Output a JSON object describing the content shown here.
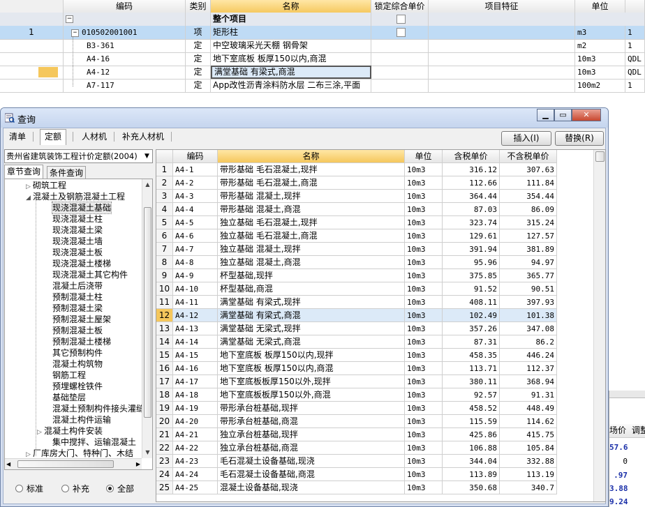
{
  "background_table": {
    "headers": [
      "编码",
      "类别",
      "名称",
      "锁定综合单价",
      "项目特征",
      "单位",
      ""
    ],
    "group_row": {
      "label": "整个项目"
    },
    "rows": [
      {
        "num": "1",
        "code": "010502001001",
        "type": "项",
        "name": "矩形柱",
        "unit": "m3",
        "qty": "1"
      },
      {
        "num": "",
        "code": "B3-361",
        "type": "定",
        "name": "中空玻璃采光天棚 钢骨架",
        "unit": "m2",
        "qty": "1"
      },
      {
        "num": "",
        "code": "A4-16",
        "type": "定",
        "name": "地下室底板 板厚150以内,商混",
        "unit": "10m3",
        "qty": "QDL"
      },
      {
        "num": "",
        "code": "A4-12",
        "type": "定",
        "name": "满堂基础 有梁式,商混",
        "unit": "10m3",
        "qty": "QDL"
      },
      {
        "num": "",
        "code": "A7-117",
        "type": "定",
        "name": "App改性沥青涂料防水层 二布三涂,平面",
        "unit": "100m2",
        "qty": "1"
      }
    ]
  },
  "dialog": {
    "title": "查询",
    "tabs": [
      "清单",
      "定额",
      "人材机",
      "补充人材机"
    ],
    "active_tab": "定额",
    "insert_button": "插入(I)",
    "replace_button": "替换(R)",
    "quota_library": "贵州省建筑装饰工程计价定额(2004)",
    "left_tabs": [
      "章节查询",
      "条件查询"
    ],
    "tree": [
      {
        "label": "砌筑工程",
        "level": 1,
        "toggle": "▷"
      },
      {
        "label": "混凝土及钢筋混凝土工程",
        "level": 1,
        "toggle": "◢"
      },
      {
        "label": "现浇混凝土基础",
        "level": 2,
        "toggle": "",
        "selected": true
      },
      {
        "label": "现浇混凝土柱",
        "level": 2,
        "toggle": ""
      },
      {
        "label": "现浇混凝土梁",
        "level": 2,
        "toggle": ""
      },
      {
        "label": "现浇混凝土墙",
        "level": 2,
        "toggle": ""
      },
      {
        "label": "现浇混凝土板",
        "level": 2,
        "toggle": ""
      },
      {
        "label": "现浇混凝土楼梯",
        "level": 2,
        "toggle": ""
      },
      {
        "label": "现浇混凝土其它构件",
        "level": 2,
        "toggle": ""
      },
      {
        "label": "混凝土后浇带",
        "level": 2,
        "toggle": ""
      },
      {
        "label": "预制混凝土柱",
        "level": 2,
        "toggle": ""
      },
      {
        "label": "预制混凝土梁",
        "level": 2,
        "toggle": ""
      },
      {
        "label": "预制混凝土屋架",
        "level": 2,
        "toggle": ""
      },
      {
        "label": "预制混凝土板",
        "level": 2,
        "toggle": ""
      },
      {
        "label": "预制混凝土楼梯",
        "level": 2,
        "toggle": ""
      },
      {
        "label": "其它预制构件",
        "level": 2,
        "toggle": ""
      },
      {
        "label": "混凝土构筑物",
        "level": 2,
        "toggle": ""
      },
      {
        "label": "钢筋工程",
        "level": 2,
        "toggle": ""
      },
      {
        "label": "预埋螺栓铁件",
        "level": 2,
        "toggle": ""
      },
      {
        "label": "基础垫层",
        "level": 2,
        "toggle": ""
      },
      {
        "label": "混凝土预制构件接头灌缝",
        "level": 2,
        "toggle": ""
      },
      {
        "label": "混凝土构件运输",
        "level": 2,
        "toggle": ""
      },
      {
        "label": "混凝土构件安装",
        "level": 2,
        "toggle": "▷"
      },
      {
        "label": "集中搅拌、运输混凝土",
        "level": 2,
        "toggle": ""
      },
      {
        "label": "厂库房大门、特种门、木结",
        "level": 1,
        "toggle": "▷"
      }
    ],
    "filter_options": [
      "标准",
      "补充",
      "全部"
    ],
    "filter_selected": "全部",
    "grid": {
      "headers": [
        "",
        "编码",
        "名称",
        "单位",
        "含税单价",
        "不含税单价"
      ],
      "rows": [
        {
          "n": "1",
          "code": "A4-1",
          "name": "带形基础 毛石混凝土,现拌",
          "unit": "10m3",
          "p1": "316.12",
          "p2": "307.63"
        },
        {
          "n": "2",
          "code": "A4-2",
          "name": "带形基础 毛石混凝土,商混",
          "unit": "10m3",
          "p1": "112.66",
          "p2": "111.84"
        },
        {
          "n": "3",
          "code": "A4-3",
          "name": "带形基础 混凝土,现拌",
          "unit": "10m3",
          "p1": "364.44",
          "p2": "354.44"
        },
        {
          "n": "4",
          "code": "A4-4",
          "name": "带形基础 混凝土,商混",
          "unit": "10m3",
          "p1": "87.03",
          "p2": "86.09"
        },
        {
          "n": "5",
          "code": "A4-5",
          "name": "独立基础 毛石混凝土,现拌",
          "unit": "10m3",
          "p1": "323.74",
          "p2": "315.24"
        },
        {
          "n": "6",
          "code": "A4-6",
          "name": "独立基础 毛石混凝土,商混",
          "unit": "10m3",
          "p1": "129.61",
          "p2": "127.57"
        },
        {
          "n": "7",
          "code": "A4-7",
          "name": "独立基础 混凝土,现拌",
          "unit": "10m3",
          "p1": "391.94",
          "p2": "381.89"
        },
        {
          "n": "8",
          "code": "A4-8",
          "name": "独立基础 混凝土,商混",
          "unit": "10m3",
          "p1": "95.96",
          "p2": "94.97"
        },
        {
          "n": "9",
          "code": "A4-9",
          "name": "杯型基础,现拌",
          "unit": "10m3",
          "p1": "375.85",
          "p2": "365.77"
        },
        {
          "n": "10",
          "code": "A4-10",
          "name": "杯型基础,商混",
          "unit": "10m3",
          "p1": "91.52",
          "p2": "90.51"
        },
        {
          "n": "11",
          "code": "A4-11",
          "name": "满堂基础 有梁式,现拌",
          "unit": "10m3",
          "p1": "408.11",
          "p2": "397.93"
        },
        {
          "n": "12",
          "code": "A4-12",
          "name": "满堂基础 有梁式,商混",
          "unit": "10m3",
          "p1": "102.49",
          "p2": "101.38",
          "selected": true
        },
        {
          "n": "13",
          "code": "A4-13",
          "name": "满堂基础 无梁式,现拌",
          "unit": "10m3",
          "p1": "357.26",
          "p2": "347.08"
        },
        {
          "n": "14",
          "code": "A4-14",
          "name": "满堂基础 无梁式,商混",
          "unit": "10m3",
          "p1": "87.31",
          "p2": "86.2"
        },
        {
          "n": "15",
          "code": "A4-15",
          "name": "地下室底板 板厚150以内,现拌",
          "unit": "10m3",
          "p1": "458.35",
          "p2": "446.24"
        },
        {
          "n": "16",
          "code": "A4-16",
          "name": "地下室底板 板厚150以内,商混",
          "unit": "10m3",
          "p1": "113.71",
          "p2": "112.37"
        },
        {
          "n": "17",
          "code": "A4-17",
          "name": "地下室底板板厚150以外,现拌",
          "unit": "10m3",
          "p1": "380.11",
          "p2": "368.94"
        },
        {
          "n": "18",
          "code": "A4-18",
          "name": "地下室底板板厚150以外,商混",
          "unit": "10m3",
          "p1": "92.57",
          "p2": "91.31"
        },
        {
          "n": "19",
          "code": "A4-19",
          "name": "带形承台桩基础,现拌",
          "unit": "10m3",
          "p1": "458.52",
          "p2": "448.49"
        },
        {
          "n": "20",
          "code": "A4-20",
          "name": "带形承台桩基础,商混",
          "unit": "10m3",
          "p1": "115.59",
          "p2": "114.62"
        },
        {
          "n": "21",
          "code": "A4-21",
          "name": "独立承台桩基础,现拌",
          "unit": "10m3",
          "p1": "425.86",
          "p2": "415.75"
        },
        {
          "n": "22",
          "code": "A4-22",
          "name": "独立承台桩基础,商混",
          "unit": "10m3",
          "p1": "106.88",
          "p2": "105.84"
        },
        {
          "n": "23",
          "code": "A4-23",
          "name": "毛石混凝土设备基础,现浇",
          "unit": "10m3",
          "p1": "344.04",
          "p2": "332.88"
        },
        {
          "n": "24",
          "code": "A4-24",
          "name": "毛石混凝土设备基础,商混",
          "unit": "10m3",
          "p1": "113.89",
          "p2": "113.19"
        },
        {
          "n": "25",
          "code": "A4-25",
          "name": "混凝土设备基础,现浇",
          "unit": "10m3",
          "p1": "350.68",
          "p2": "340.7"
        }
      ]
    }
  },
  "right_fragment": {
    "headers": [
      "场价",
      "调整"
    ],
    "values": [
      "57.6",
      "0",
      ".97",
      "3.88",
      "9.24"
    ]
  }
}
